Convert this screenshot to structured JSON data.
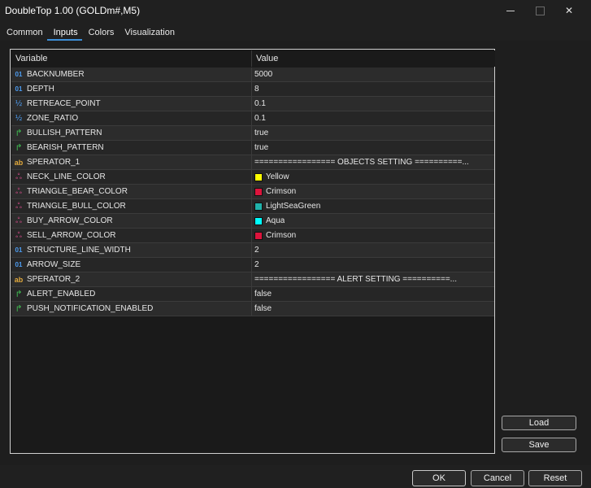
{
  "window": {
    "title": "DoubleTop 1.00 (GOLDm#,M5)",
    "minimize_glyph": "—",
    "maximize_glyph": "☐",
    "close_glyph": "✕"
  },
  "tabs": [
    {
      "label": "Common",
      "active": false
    },
    {
      "label": "Inputs",
      "active": true
    },
    {
      "label": "Colors",
      "active": false
    },
    {
      "label": "Visualization",
      "active": false
    }
  ],
  "grid": {
    "header": {
      "variable": "Variable",
      "value": "Value"
    },
    "icon_glyphs": {
      "int": "01",
      "double": "½",
      "bool": "↱",
      "string": "ab",
      "color": "ஃ"
    },
    "rows": [
      {
        "type": "int",
        "icon": "int-type-icon",
        "name": "BACKNUMBER",
        "value": "5000"
      },
      {
        "type": "int",
        "icon": "int-type-icon",
        "name": "DEPTH",
        "value": "8"
      },
      {
        "type": "double",
        "icon": "double-type-icon",
        "name": "RETREACE_POINT",
        "value": "0.1"
      },
      {
        "type": "double",
        "icon": "double-type-icon",
        "name": "ZONE_RATIO",
        "value": "0.1"
      },
      {
        "type": "bool",
        "icon": "bool-type-icon",
        "name": "BULLISH_PATTERN",
        "value": "true"
      },
      {
        "type": "bool",
        "icon": "bool-type-icon",
        "name": "BEARISH_PATTERN",
        "value": "true"
      },
      {
        "type": "string",
        "icon": "string-type-icon",
        "name": "SPERATOR_1",
        "value": "================= OBJECTS SETTING ==========..."
      },
      {
        "type": "color",
        "icon": "color-type-icon",
        "name": "NECK_LINE_COLOR",
        "value": "Yellow",
        "swatch": "#ffff00"
      },
      {
        "type": "color",
        "icon": "color-type-icon",
        "name": "TRIANGLE_BEAR_COLOR",
        "value": "Crimson",
        "swatch": "#dc143c"
      },
      {
        "type": "color",
        "icon": "color-type-icon",
        "name": "TRIANGLE_BULL_COLOR",
        "value": "LightSeaGreen",
        "swatch": "#20b2aa"
      },
      {
        "type": "color",
        "icon": "color-type-icon",
        "name": "BUY_ARROW_COLOR",
        "value": "Aqua",
        "swatch": "#00ffff"
      },
      {
        "type": "color",
        "icon": "color-type-icon",
        "name": "SELL_ARROW_COLOR",
        "value": "Crimson",
        "swatch": "#dc143c"
      },
      {
        "type": "int",
        "icon": "int-type-icon",
        "name": "STRUCTURE_LINE_WIDTH",
        "value": "2"
      },
      {
        "type": "int",
        "icon": "int-type-icon",
        "name": "ARROW_SIZE",
        "value": "2"
      },
      {
        "type": "string",
        "icon": "string-type-icon",
        "name": "SPERATOR_2",
        "value": "================= ALERT SETTING ==========..."
      },
      {
        "type": "bool",
        "icon": "bool-type-icon",
        "name": "ALERT_ENABLED",
        "value": "false"
      },
      {
        "type": "bool",
        "icon": "bool-type-icon",
        "name": "PUSH_NOTIFICATION_ENABLED",
        "value": "false"
      }
    ]
  },
  "side_buttons": {
    "load": "Load",
    "save": "Save"
  },
  "footer_buttons": {
    "ok": "OK",
    "cancel": "Cancel",
    "reset": "Reset"
  }
}
